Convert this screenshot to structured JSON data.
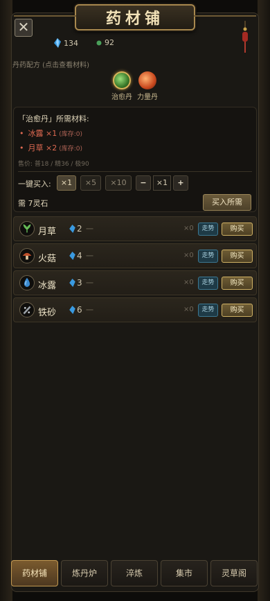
{
  "window": {
    "title": "药材铺"
  },
  "currency": {
    "spirit_stone": "134",
    "jade": "92"
  },
  "formula": {
    "label": "丹药配方 (点击查看材料)",
    "pills": [
      {
        "name": "治愈丹",
        "color": "#4a9a3a",
        "selected": true
      },
      {
        "name": "力量丹",
        "color": "#c84a22",
        "selected": false
      }
    ]
  },
  "recipe": {
    "header": "「治愈丹」所需材料:",
    "materials": [
      {
        "text": "冰露 ×1",
        "stock": "(库存:0)"
      },
      {
        "text": "月草 ×2",
        "stock": "(库存:0)"
      }
    ],
    "price": "售价: 普18 / 精36 / 极90",
    "buy_label": "一键买入:",
    "quantities": [
      "×1",
      "×5",
      "×10"
    ],
    "minus": "−",
    "qty_value": "×1",
    "plus": "+",
    "need": "需 7灵石",
    "buy_all": "买入所需"
  },
  "items": [
    {
      "name": "月草",
      "price": "2",
      "dash": "一",
      "owned": "×0",
      "trend": "走势",
      "buy": "购买",
      "icon": "herb-icon",
      "icon_color": "#5a9a4a"
    },
    {
      "name": "火菇",
      "price": "4",
      "dash": "一",
      "owned": "×0",
      "trend": "走势",
      "buy": "购买",
      "icon": "mushroom-icon",
      "icon_color": "#c0502a"
    },
    {
      "name": "冰露",
      "price": "3",
      "dash": "一",
      "owned": "×0",
      "trend": "走势",
      "buy": "购买",
      "icon": "dew-icon",
      "icon_color": "#3a8ad0"
    },
    {
      "name": "铁砂",
      "price": "6",
      "dash": "一",
      "owned": "×0",
      "trend": "走势",
      "buy": "购买",
      "icon": "iron-sand-icon",
      "icon_color": "#9aa0a6"
    }
  ],
  "tabs": [
    {
      "label": "药材铺",
      "active": true
    },
    {
      "label": "炼丹炉",
      "active": false
    },
    {
      "label": "淬炼",
      "active": false
    },
    {
      "label": "集市",
      "active": false
    },
    {
      "label": "灵草阁",
      "active": false
    }
  ]
}
